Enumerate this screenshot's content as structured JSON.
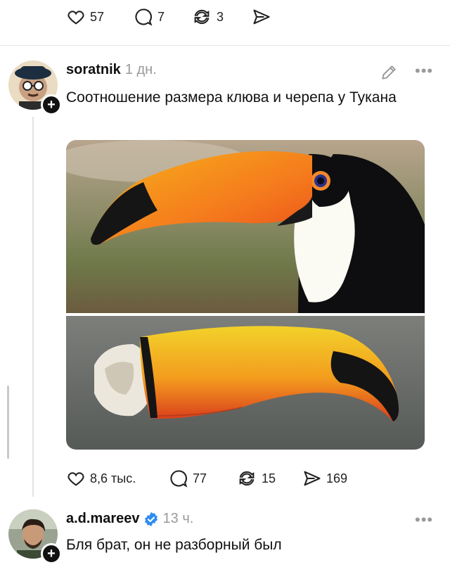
{
  "prev_post_actions": {
    "likes": "57",
    "comments": "7",
    "reposts": "3"
  },
  "post": {
    "username": "soratnik",
    "time": "1 дн.",
    "text": "Соотношение размера клюва и черепа у Тукана",
    "actions": {
      "likes": "8,6 тыс.",
      "comments": "77",
      "reposts": "15",
      "shares": "169"
    }
  },
  "reply": {
    "username": "a.d.mareev",
    "time": "13 ч.",
    "text": "Бля брат, он не разборный был",
    "verified": true
  },
  "colors": {
    "verified": "#2f8cf0",
    "muted": "#9a9a9a"
  }
}
